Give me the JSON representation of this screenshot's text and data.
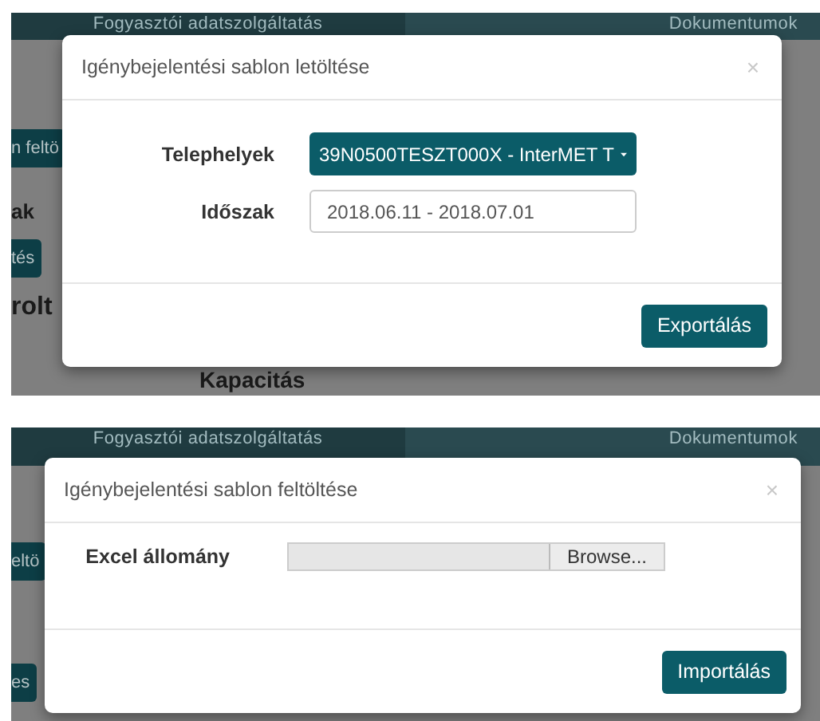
{
  "screens": [
    {
      "navbar": [
        "Fogyasztói adatszolgáltatás",
        "Dokumentumok"
      ],
      "background": [
        {
          "kind": "button",
          "text": "n feltö"
        },
        {
          "kind": "heading",
          "text": "ak"
        },
        {
          "kind": "button",
          "text": "tés"
        },
        {
          "kind": "title",
          "text": "rolt"
        },
        {
          "kind": "subtitle",
          "text": "Kapacitás"
        }
      ],
      "modal": {
        "title": "Igénybejelentési sablon letöltése",
        "close": "×",
        "fields": [
          {
            "kind": "select",
            "label": "Telephelyek",
            "value": "39N0500TESZT000X - InterMET T"
          },
          {
            "kind": "input",
            "label": "Időszak",
            "value": "2018.06.11 - 2018.07.01"
          }
        ],
        "button": "Exportálás"
      }
    },
    {
      "navbar": [
        "Fogyasztói adatszolgáltatás",
        "Dokumentumok"
      ],
      "background": [
        {
          "kind": "button",
          "text": "eltö"
        },
        {
          "kind": "button",
          "text": "es"
        }
      ],
      "modal": {
        "title": "Igénybejelentési sablon feltöltése",
        "close": "×",
        "fields": [
          {
            "kind": "file",
            "label": "Excel állomány",
            "value": "Browse..."
          }
        ],
        "button": "Importálás"
      }
    }
  ]
}
